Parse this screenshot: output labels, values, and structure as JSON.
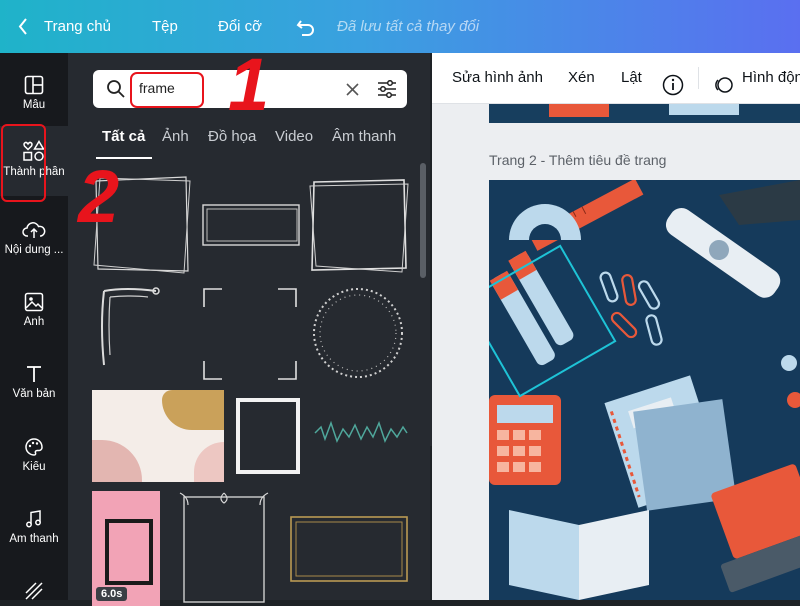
{
  "topbar": {
    "home": "Trang chủ",
    "file": "Tệp",
    "resize": "Đổi cỡ",
    "saved_status": "Đã lưu tất cả thay đổi"
  },
  "rail": [
    {
      "label": "Mẫu",
      "icon": "template-icon"
    },
    {
      "label": "Thành phần",
      "icon": "elements-icon"
    },
    {
      "label": "Nội dung ...",
      "icon": "upload-cloud-icon"
    },
    {
      "label": "Ảnh",
      "icon": "photo-icon"
    },
    {
      "label": "Văn bản",
      "icon": "text-icon"
    },
    {
      "label": "Kiểu",
      "icon": "palette-icon"
    },
    {
      "label": "Âm thanh",
      "icon": "music-note-icon"
    }
  ],
  "search": {
    "value": "frame"
  },
  "tabs": [
    "Tất cả",
    "Ảnh",
    "Đồ họa",
    "Video",
    "Âm thanh"
  ],
  "video_badge": "6.0s",
  "editbar": {
    "edit_image": "Sửa hình ảnh",
    "crop": "Xén",
    "flip": "Lật",
    "animate": "Hình độn"
  },
  "page2_title": "Trang 2 - Thêm tiêu đề trang",
  "annotations": {
    "one": "1",
    "two": "2"
  },
  "colors": {
    "accent_red": "#e8141c",
    "canvas_navy": "#153a5b",
    "orange": "#e8583a",
    "light_blue": "#bcd9ec"
  }
}
